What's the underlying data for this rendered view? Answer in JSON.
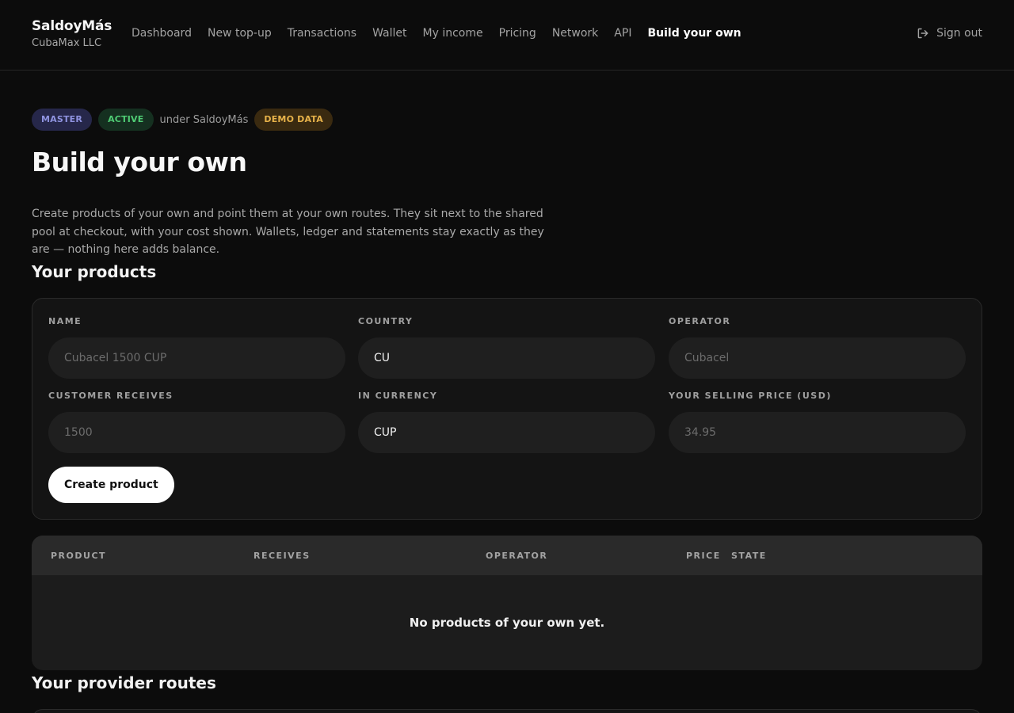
{
  "brand": {
    "name": "SaldoyMás",
    "company": "CubaMax LLC"
  },
  "nav": {
    "items": [
      {
        "label": "Dashboard"
      },
      {
        "label": "New top-up"
      },
      {
        "label": "Transactions"
      },
      {
        "label": "Wallet"
      },
      {
        "label": "My income"
      },
      {
        "label": "Pricing"
      },
      {
        "label": "Network"
      },
      {
        "label": "API"
      },
      {
        "label": "Build your own",
        "active": true
      }
    ],
    "sign_out": "Sign out"
  },
  "status": {
    "master": "MASTER",
    "active": "ACTIVE",
    "under": "under SaldoyMás",
    "demo": "DEMO DATA"
  },
  "page": {
    "title": "Build your own",
    "description": "Create products of your own and point them at your own routes. They sit next to the shared pool at checkout, with your cost shown. Wallets, ledger and statements stay exactly as they are — nothing here adds balance."
  },
  "products": {
    "section_title": "Your products",
    "form": {
      "name": {
        "label": "NAME",
        "value": "",
        "placeholder": "Cubacel 1500 CUP"
      },
      "country": {
        "label": "COUNTRY",
        "value": "CU",
        "placeholder": ""
      },
      "operator": {
        "label": "OPERATOR",
        "value": "",
        "placeholder": "Cubacel"
      },
      "receives": {
        "label": "CUSTOMER RECEIVES",
        "value": "",
        "placeholder": "1500"
      },
      "currency": {
        "label": "IN CURRENCY",
        "value": "CUP",
        "placeholder": ""
      },
      "price": {
        "label": "YOUR SELLING PRICE (USD)",
        "value": "",
        "placeholder": "34.95"
      }
    },
    "create_button": "Create product",
    "table": {
      "columns": [
        "PRODUCT",
        "RECEIVES",
        "OPERATOR",
        "PRICE",
        "STATE"
      ],
      "empty": "No products of your own yet."
    }
  },
  "routes": {
    "section_title": "Your provider routes"
  }
}
